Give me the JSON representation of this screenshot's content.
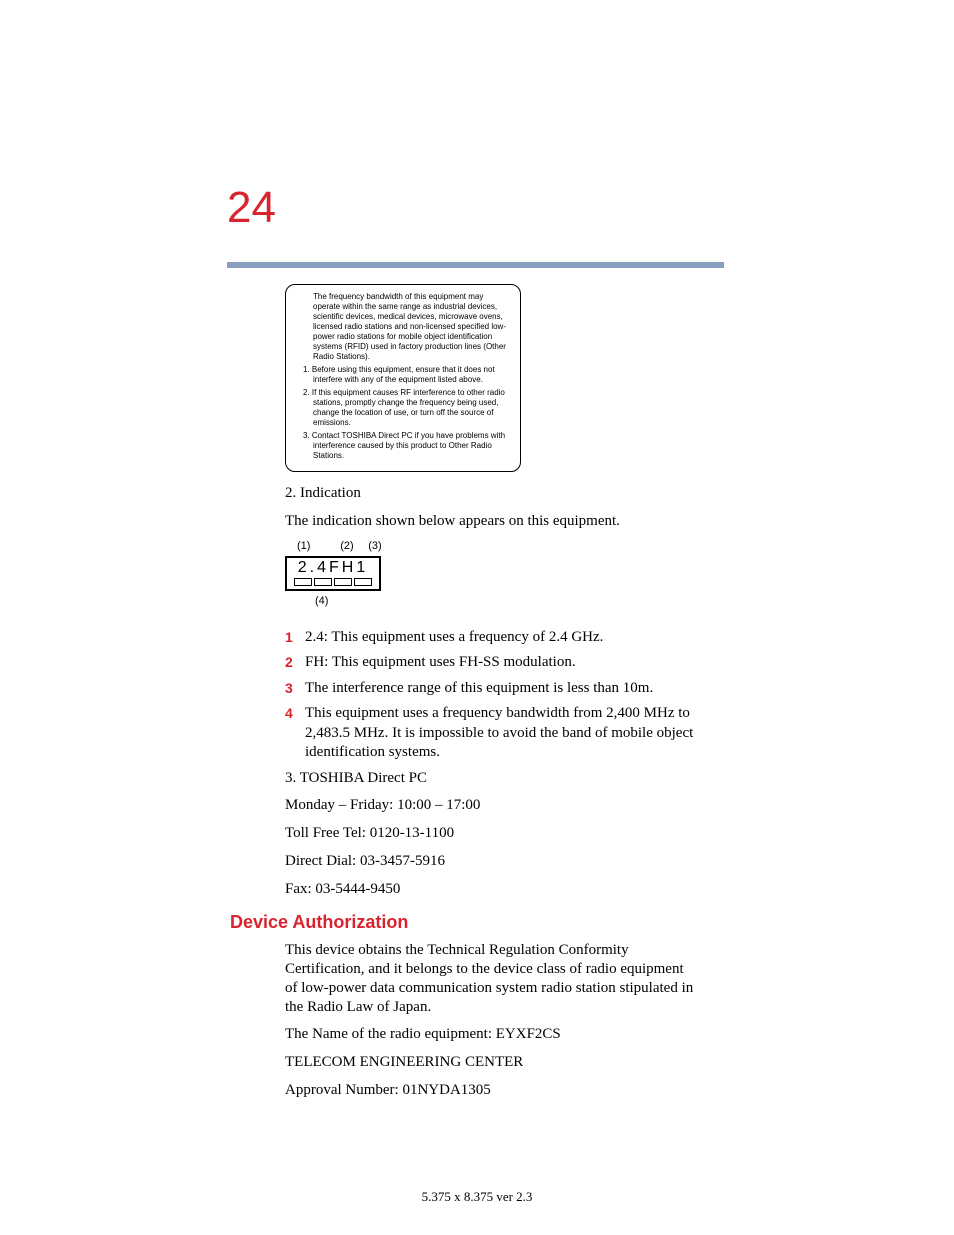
{
  "page_number": "24",
  "notice": {
    "intro": "The frequency bandwidth of this equipment may operate within the same range as industrial devices, scientific devices, medical devices, microwave ovens, licensed radio stations and non-licensed specified low-power radio stations for mobile object identification systems (RFID) used in factory production lines (Other Radio Stations).",
    "item1": "1. Before using this equipment, ensure that it does not interfere with any of the equipment listed above.",
    "item2": "2. If this equipment causes RF interference to other radio stations, promptly change the frequency being used, change the location of use, or turn off the source of emissions.",
    "item3": "3. Contact TOSHIBA Direct PC if you have problems with interference caused by this product to Other Radio Stations."
  },
  "section2": {
    "heading": "2. Indication",
    "text": "The indication shown below appears on this equipment."
  },
  "indication": {
    "top1": "(1)",
    "top2": "(2)",
    "top3": "(3)",
    "label": "2.4FH1",
    "bottom": "(4)"
  },
  "list": {
    "i1": {
      "n": "1",
      "t": "2.4: This equipment uses a frequency of 2.4 GHz."
    },
    "i2": {
      "n": "2",
      "t": "FH: This equipment uses FH-SS modulation."
    },
    "i3": {
      "n": "3",
      "t": "The interference range of this equipment is less than 10m."
    },
    "i4": {
      "n": "4",
      "t": "This equipment uses a frequency bandwidth from 2,400 MHz to 2,483.5 MHz. It is impossible to avoid the band of mobile object identification systems."
    }
  },
  "contact": {
    "heading": "3. TOSHIBA Direct PC",
    "hours": "Monday – Friday: 10:00 – 17:00",
    "tollfree": "Toll Free Tel: 0120-13-1100",
    "direct": "Direct Dial: 03-3457-5916",
    "fax": "Fax: 03-5444-9450"
  },
  "auth": {
    "title": "Device Authorization",
    "p1": "This device obtains the Technical Regulation Conformity Certification, and it belongs to the device class of radio equipment of low-power data communication system radio station stipulated in the Radio Law of Japan.",
    "p2": "The Name of the radio equipment: EYXF2CS",
    "p3": "TELECOM ENGINEERING CENTER",
    "p4": "Approval Number: 01NYDA1305"
  },
  "footer": "5.375 x 8.375 ver 2.3"
}
